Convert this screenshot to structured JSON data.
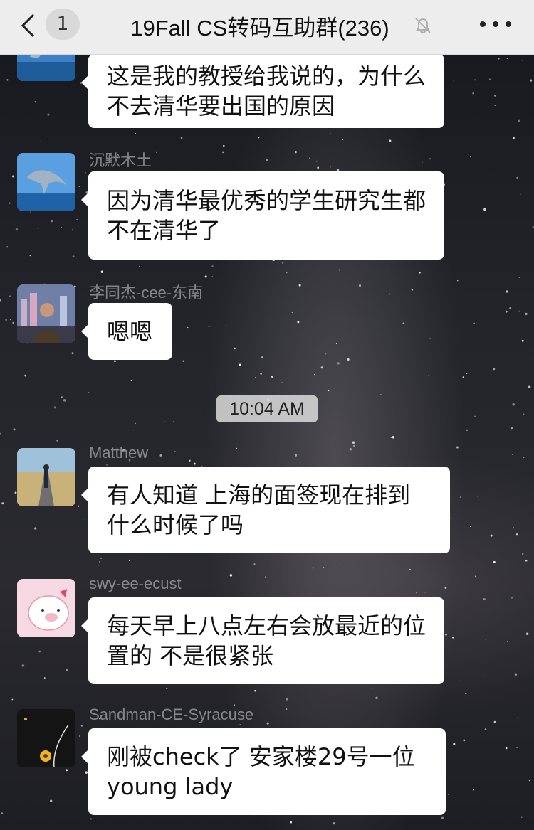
{
  "header": {
    "back_label": "<",
    "unread_count": "1",
    "title": "19Fall CS转码互助群(236)",
    "muted": true,
    "more_icon": "more-dots-icon"
  },
  "messages": [
    {
      "sender": "",
      "avatar": "dolphin-avatar",
      "text": "这是我的教授给我说的，为什么不去清华要出国的原因"
    },
    {
      "sender": "沉默木土",
      "avatar": "dolphin-avatar",
      "text": "因为清华最优秀的学生研究生都不在清华了"
    },
    {
      "sender": "李同杰-cee-东南",
      "avatar": "man-city-avatar",
      "text": "嗯嗯"
    },
    {
      "sender": "Matthew",
      "avatar": "road-avatar",
      "text": "有人知道 上海的面签现在排到什么时候了吗"
    },
    {
      "sender": "swy-ee-ecust",
      "avatar": "pig-avatar",
      "text": "每天早上八点左右会放最近的位置的 不是很紧张"
    },
    {
      "sender": "Sandman-CE-Syracuse",
      "avatar": "sunflower-avatar",
      "text": "刚被check了 安家楼29号一位young lady"
    }
  ],
  "timestamp": "10:04 AM",
  "colors": {
    "header_bg": "#ededed",
    "bubble_bg": "#ffffff",
    "timestamp_bg": "#dcdcdc"
  }
}
